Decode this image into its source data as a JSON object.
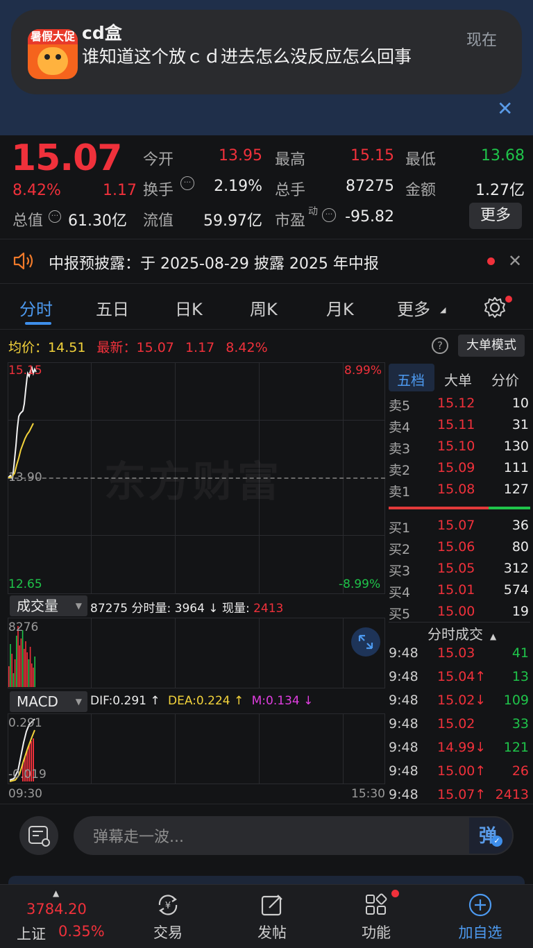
{
  "notification": {
    "app_icon_text": "暑假大促",
    "title": "cd盒",
    "message": "谁知道这个放ｃｄ进去怎么没反应怎么回事",
    "time": "现在"
  },
  "quote": {
    "price": "15.07",
    "change_pct": "8.42%",
    "change": "1.17",
    "open_label": "今开",
    "open": "13.95",
    "high_label": "最高",
    "high": "15.15",
    "low_label": "最低",
    "low": "13.68",
    "turnover_label": "换手",
    "turnover": "2.19%",
    "volume_label": "总手",
    "volume": "87275",
    "amount_label": "金额",
    "amount": "1.27亿",
    "mktcap_label": "总值",
    "mktcap": "61.30亿",
    "float_label": "流值",
    "float": "59.97亿",
    "pe_label": "市盈",
    "pe_super": "动",
    "pe": "-95.82",
    "more_button": "更多"
  },
  "notice": {
    "text": "中报预披露：于 2025-08-29 披露 2025 年中报"
  },
  "tabs": [
    "分时",
    "五日",
    "日K",
    "周K",
    "月K",
    "更多"
  ],
  "info": {
    "avg_label": "均价：",
    "avg": "14.51",
    "latest_label": "最新：",
    "latest": "15.07",
    "latest_change": "1.17",
    "latest_pct": "8.42%",
    "mode_button": "大单模式"
  },
  "chart_labels": {
    "high_price": "15.15",
    "mid_price": "13.90",
    "low_price": "12.65",
    "high_pct": "8.99%",
    "low_pct": "-8.99%",
    "watermark": "东方财富",
    "vol_max": "8276",
    "macd_top": "0.291",
    "macd_bottom": "-0.019",
    "time_start": "09:30",
    "time_end": "15:30"
  },
  "volume_panel": {
    "selector": "成交量",
    "total": "87275",
    "period_label": "分时量:",
    "period_value": "3964 ↓",
    "now_label": "现量:",
    "now_value": "2413"
  },
  "macd_panel": {
    "selector": "MACD",
    "dif": "DIF:0.291 ↑",
    "dea": "DEA:0.224 ↑",
    "m": "M:0.134 ↓"
  },
  "orderbook": {
    "tabs": [
      "五档",
      "大单",
      "分价"
    ],
    "asks": [
      {
        "label": "卖5",
        "price": "15.12",
        "vol": "10"
      },
      {
        "label": "卖4",
        "price": "15.11",
        "vol": "31"
      },
      {
        "label": "卖3",
        "price": "15.10",
        "vol": "130"
      },
      {
        "label": "卖2",
        "price": "15.09",
        "vol": "111"
      },
      {
        "label": "卖1",
        "price": "15.08",
        "vol": "127"
      }
    ],
    "bids": [
      {
        "label": "买1",
        "price": "15.07",
        "vol": "36"
      },
      {
        "label": "买2",
        "price": "15.06",
        "vol": "80"
      },
      {
        "label": "买3",
        "price": "15.05",
        "vol": "312"
      },
      {
        "label": "买4",
        "price": "15.01",
        "vol": "574"
      },
      {
        "label": "买5",
        "price": "15.00",
        "vol": "19"
      }
    ],
    "ticks_title": "分时成交",
    "ticks": [
      {
        "time": "9:48",
        "price": "15.03",
        "vol": "41",
        "dir": "green"
      },
      {
        "time": "9:48",
        "price": "15.04↑",
        "vol": "13",
        "dir": "green"
      },
      {
        "time": "9:48",
        "price": "15.02↓",
        "vol": "109",
        "dir": "green"
      },
      {
        "time": "9:48",
        "price": "15.02",
        "vol": "33",
        "dir": "green"
      },
      {
        "time": "9:48",
        "price": "14.99↓",
        "vol": "121",
        "dir": "green"
      },
      {
        "time": "9:48",
        "price": "15.00↑",
        "vol": "26",
        "dir": "red"
      },
      {
        "time": "9:48",
        "price": "15.07↑",
        "vol": "2413",
        "dir": "red"
      }
    ]
  },
  "danmaku": {
    "placeholder": "弹幕走一波...",
    "button": "弹"
  },
  "bottom_bar": {
    "index_value": "3784.20",
    "index_name": "上证",
    "index_pct": "0.35%",
    "items": [
      "交易",
      "发帖",
      "功能",
      "加自选"
    ]
  },
  "colors": {
    "up": "#f0313b",
    "down": "#1fc44a",
    "accent": "#4d9af0",
    "avg_line": "#f3d33b"
  }
}
